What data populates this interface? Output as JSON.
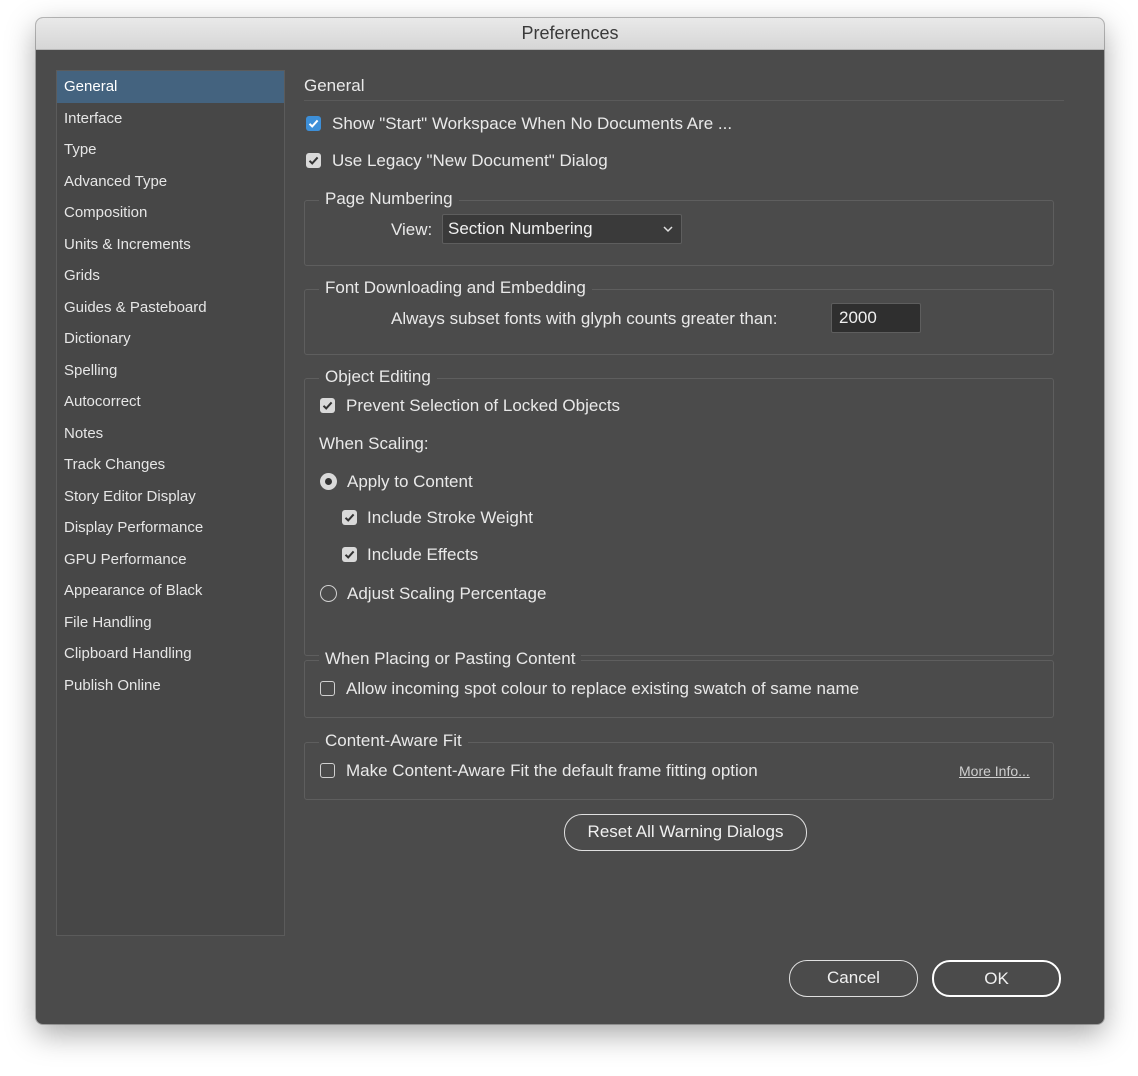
{
  "window": {
    "title": "Preferences"
  },
  "sidebar": {
    "items": [
      {
        "label": "General"
      },
      {
        "label": "Interface"
      },
      {
        "label": "Type"
      },
      {
        "label": "Advanced Type"
      },
      {
        "label": "Composition"
      },
      {
        "label": "Units & Increments"
      },
      {
        "label": "Grids"
      },
      {
        "label": "Guides & Pasteboard"
      },
      {
        "label": "Dictionary"
      },
      {
        "label": "Spelling"
      },
      {
        "label": "Autocorrect"
      },
      {
        "label": "Notes"
      },
      {
        "label": "Track Changes"
      },
      {
        "label": "Story Editor Display"
      },
      {
        "label": "Display Performance"
      },
      {
        "label": "GPU Performance"
      },
      {
        "label": "Appearance of Black"
      },
      {
        "label": "File Handling"
      },
      {
        "label": "Clipboard Handling"
      },
      {
        "label": "Publish Online"
      }
    ],
    "selected": "General"
  },
  "general": {
    "heading": "General",
    "show_start_label": "Show \"Start\" Workspace When No Documents Are ...",
    "show_start_checked": true,
    "legacy_label": "Use Legacy \"New Document\" Dialog",
    "legacy_checked": true
  },
  "page_numbering": {
    "title": "Page Numbering",
    "view_label": "View:",
    "view_value": "Section Numbering"
  },
  "fonts": {
    "title": "Font Downloading and Embedding",
    "subset_label": "Always subset fonts with glyph counts greater than:",
    "subset_value": "2000"
  },
  "object_editing": {
    "title": "Object Editing",
    "prevent_label": "Prevent Selection of Locked Objects",
    "prevent_checked": true,
    "when_scaling": "When Scaling:",
    "apply_label": "Apply to Content",
    "apply_selected": true,
    "stroke_label": "Include Stroke Weight",
    "stroke_checked": true,
    "effects_label": "Include Effects",
    "effects_checked": true,
    "adjust_label": "Adjust Scaling Percentage",
    "adjust_selected": false
  },
  "placing": {
    "title": "When Placing or Pasting Content",
    "allow_label": "Allow incoming spot colour to replace existing swatch of same name",
    "allow_checked": false
  },
  "content_aware": {
    "title": "Content-Aware Fit",
    "make_label": "Make Content-Aware Fit the default frame fitting option",
    "make_checked": false,
    "more_info": "More Info..."
  },
  "buttons": {
    "reset": "Reset All Warning Dialogs",
    "cancel": "Cancel",
    "ok": "OK"
  },
  "colors": {
    "window_bg": "#4b4b4b",
    "selected_bg": "#44637f",
    "checkbox_blue": "#3d8fd8"
  }
}
